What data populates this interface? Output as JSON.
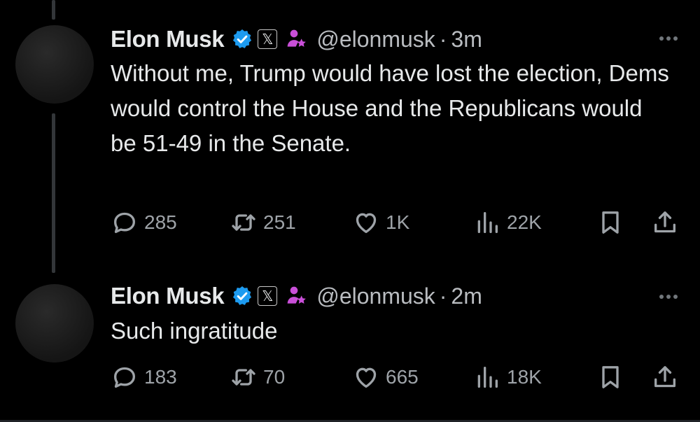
{
  "tweets": [
    {
      "author_name": "Elon Musk",
      "handle": "@elonmusk",
      "separator": "·",
      "time": "3m",
      "text": "Without me, Trump would have lost the election, Dems would control the House and the Republicans would be 51-49 in the Senate.",
      "replies": "285",
      "retweets": "251",
      "likes": "1K",
      "views": "22K"
    },
    {
      "author_name": "Elon Musk",
      "handle": "@elonmusk",
      "separator": "·",
      "time": "2m",
      "text": "Such ingratitude",
      "replies": "183",
      "retweets": "70",
      "likes": "665",
      "views": "18K"
    }
  ],
  "badges": {
    "x_label": "𝕏"
  },
  "colors": {
    "background": "#000000",
    "verified_blue": "#1d9bf0",
    "affiliate_purple": "#c94fd8",
    "muted_text": "#9ea3a8",
    "thread_line": "#333639"
  },
  "icons": [
    "verified-icon",
    "x-affiliate-icon",
    "affiliation-badge-icon",
    "more-icon",
    "reply-icon",
    "retweet-icon",
    "like-icon",
    "views-icon",
    "bookmark-icon",
    "share-icon"
  ]
}
